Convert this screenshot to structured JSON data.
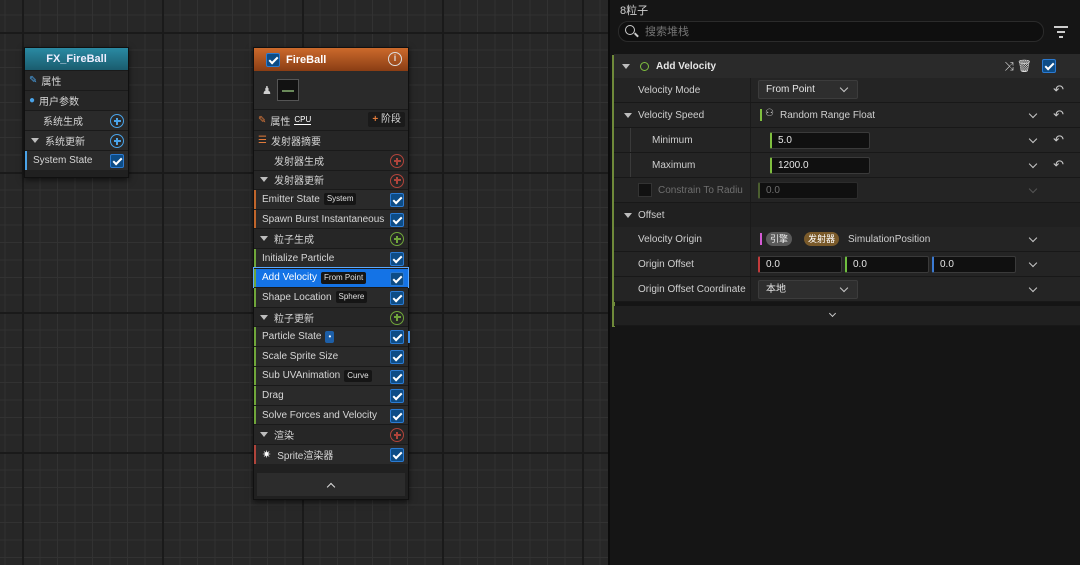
{
  "system_node": {
    "title": "FX_FireBall",
    "rows": [
      {
        "label": "属性",
        "icon": "pencil-icon"
      },
      {
        "label": "用户参数",
        "icon": "user-icon"
      },
      {
        "label": "系统生成"
      },
      {
        "label": "系统更新"
      },
      {
        "label": "System State"
      }
    ]
  },
  "emitter_node": {
    "title": "FireBall",
    "info_icon": "info-icon",
    "properties_label": "属性",
    "cpu_label": "CPU",
    "stage_label": "阶段",
    "rows": [
      {
        "label": "发射器摘要",
        "type": "summary"
      },
      {
        "label": "发射器生成",
        "type": "sub"
      },
      {
        "label": "发射器更新",
        "type": "section"
      },
      {
        "label": "Emitter State",
        "tag": "System",
        "type": "module"
      },
      {
        "label": "Spawn Burst Instantaneous",
        "type": "module"
      },
      {
        "label": "粒子生成",
        "type": "section"
      },
      {
        "label": "Initialize Particle",
        "type": "module"
      },
      {
        "label": "Add Velocity",
        "tag": "From Point",
        "type": "module",
        "selected": true
      },
      {
        "label": "Shape Location",
        "tag": "Sphere",
        "type": "module"
      },
      {
        "label": "粒子更新",
        "type": "section"
      },
      {
        "label": "Particle State",
        "tag": "•",
        "type": "module"
      },
      {
        "label": "Scale Sprite Size",
        "type": "module"
      },
      {
        "label": "Sub UVAnimation",
        "tag": "Curve",
        "type": "module"
      },
      {
        "label": "Drag",
        "type": "module"
      },
      {
        "label": "Solve Forces and Velocity",
        "type": "module"
      },
      {
        "label": "渲染",
        "type": "section"
      },
      {
        "label": "Sprite渲染器",
        "type": "render"
      }
    ],
    "collapse_icon": "chevron-up-icon"
  },
  "panel": {
    "title": "8粒子",
    "search_placeholder": "搜索堆栈",
    "header": "Add Velocity",
    "velocity_mode_label": "Velocity Mode",
    "velocity_mode_value": "From Point",
    "velocity_speed_label": "Velocity Speed",
    "velocity_speed_value": "Random Range Float",
    "minimum_label": "Minimum",
    "minimum_value": "5.0",
    "maximum_label": "Maximum",
    "maximum_value": "1200.0",
    "constrain_label": "Constrain To Radiu",
    "constrain_value": "0.0",
    "offset_label": "Offset",
    "velocity_origin_label": "Velocity Origin",
    "velocity_origin_tag1": "引擎",
    "velocity_origin_tag2": "发射器",
    "velocity_origin_value": "SimulationPosition",
    "origin_offset_label": "Origin Offset",
    "origin_offset_x": "0.0",
    "origin_offset_y": "0.0",
    "origin_offset_z": "0.0",
    "origin_coord_label": "Origin Offset Coordinate",
    "origin_coord_value": "本地"
  },
  "colors": {
    "system_header": "#1f6f84",
    "emitter_header": "#b4571e",
    "accent_blue": "#1473e6",
    "green": "#6fa63a",
    "red": "#b0443b"
  }
}
